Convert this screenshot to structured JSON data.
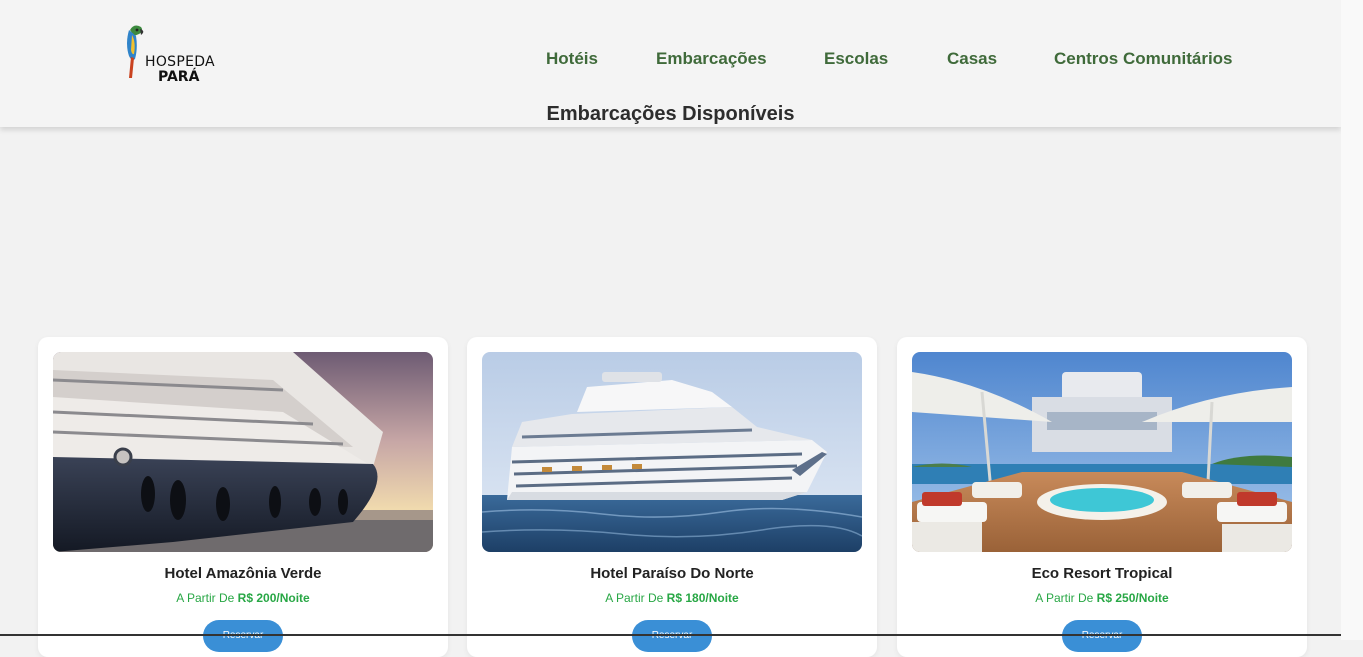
{
  "header": {
    "logo": {
      "line1": "HOSPEDA",
      "line2": "PARÁ",
      "icon": "parrot-icon"
    },
    "nav": [
      "Hotéis",
      "Embarcações",
      "Escolas",
      "Casas",
      "Centros Comunitários"
    ]
  },
  "page": {
    "title": "Embarcações Disponíveis"
  },
  "colors": {
    "nav": "#3f6a3a",
    "price": "#28a745",
    "button": "#3a8fd6"
  },
  "cards": [
    {
      "name": "Hotel Amazônia Verde",
      "price_prefix": "A Partir De",
      "price_value": "R$ 200/Noite",
      "button": "Reservar",
      "image": "yacht-photo"
    },
    {
      "name": "Hotel Paraíso Do Norte",
      "price_prefix": "A Partir De",
      "price_value": "R$ 180/Noite",
      "button": "Reservar",
      "image": "cruise-ship-photo"
    },
    {
      "name": "Eco Resort Tropical",
      "price_prefix": "A Partir De",
      "price_value": "R$ 250/Noite",
      "button": "Reservar",
      "image": "yacht-deck-pool-photo"
    }
  ]
}
